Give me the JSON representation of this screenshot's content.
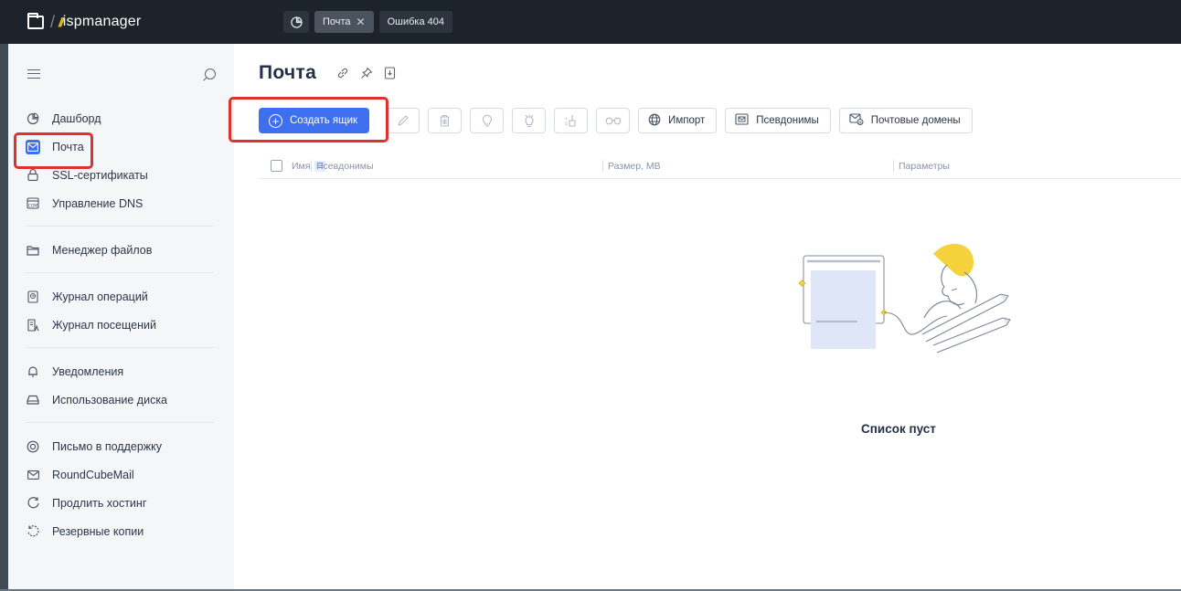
{
  "brand": {
    "name": "ispmanager",
    "mark": "//"
  },
  "tabs": [
    {
      "icon": "dashboard-icon"
    },
    {
      "label": "Почта",
      "active": true
    },
    {
      "label": "Ошибка 404",
      "active": false
    }
  ],
  "sidebar": {
    "items": [
      {
        "label": "Дашборд",
        "icon": "dashboard-icon"
      },
      {
        "label": "Почта",
        "icon": "mail-icon",
        "active": true
      },
      {
        "label": "SSL-сертификаты",
        "icon": "lock-icon"
      },
      {
        "label": "Управление DNS",
        "icon": "dns-icon"
      },
      {
        "label": "Менеджер файлов",
        "icon": "folder-icon"
      },
      {
        "label": "Журнал операций",
        "icon": "operations-log-icon"
      },
      {
        "label": "Журнал посещений",
        "icon": "visits-log-icon"
      },
      {
        "label": "Уведомления",
        "icon": "bell-icon"
      },
      {
        "label": "Использование диска",
        "icon": "disk-icon"
      },
      {
        "label": "Письмо в поддержку",
        "icon": "support-icon"
      },
      {
        "label": "RoundCubeMail",
        "icon": "mail-icon"
      },
      {
        "label": "Продлить хостинг",
        "icon": "renew-icon"
      },
      {
        "label": "Резервные копии",
        "icon": "backup-icon"
      }
    ]
  },
  "main": {
    "title": "Почта",
    "toolbar": {
      "create": "Создать ящик",
      "import": "Импорт",
      "aliases": "Псевдонимы",
      "domains": "Почтовые домены"
    },
    "table": {
      "columns": [
        "Имя",
        "Псевдонимы",
        "Размер, MB",
        "Параметры"
      ]
    },
    "empty_text": "Список пуст"
  },
  "colors": {
    "accent": "#3e6ff0",
    "highlight": "#e03131",
    "topbar": "#1d232b",
    "illustration_yellow": "#f5d23c"
  }
}
